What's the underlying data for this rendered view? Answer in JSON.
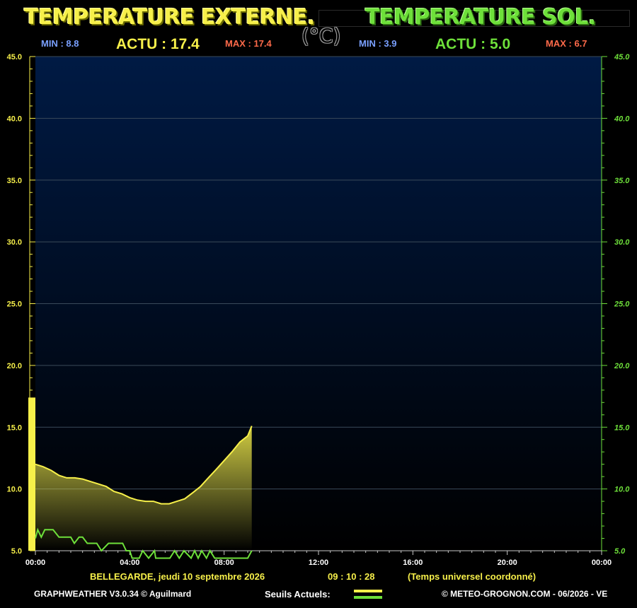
{
  "header": {
    "title_ext": "TEMPERATURE EXTERNE.",
    "title_sol": "TEMPERATURE SOL.",
    "unit": "(°C)"
  },
  "ext": {
    "min_label": "MIN : 8.8",
    "actu_label": "ACTU : 17.4",
    "max_label": "MAX : 17.4"
  },
  "sol": {
    "min_label": "MIN : 3.9",
    "actu_label": "ACTU : 5.0",
    "max_label": "MAX : 6.7"
  },
  "footer": {
    "location_date": "BELLEGARDE,  jeudi 10 septembre 2026",
    "time": "09 : 10 : 28",
    "timezone": "(Temps universel coordonné)",
    "software": "GRAPHWEATHER V3.0.34 © Aguilmard",
    "thresholds_label": "Seuils Actuels:",
    "copyright": "© METEO-GROGNON.COM - 06/2026 - VE"
  },
  "colors": {
    "ext": "#f7f04a",
    "sol": "#6ee03a",
    "min": "#7aa0ff",
    "max": "#ff6a4a",
    "plot_top": "#001a44",
    "plot_bottom": "#000000"
  },
  "chart_data": {
    "type": "area",
    "x_unit": "hours",
    "xlim": [
      0,
      24
    ],
    "x_ticks": [
      "00:00",
      "04:00",
      "08:00",
      "12:00",
      "16:00",
      "20:00",
      "00:00"
    ],
    "ylim": [
      5,
      45
    ],
    "y_ticks": [
      "5.0",
      "10.0",
      "15.0",
      "20.0",
      "25.0",
      "30.0",
      "35.0",
      "40.0",
      "45.0"
    ],
    "grid": true,
    "series": [
      {
        "key": "ext",
        "color": "#f7f04a",
        "fill": true,
        "x": [
          0,
          0.33,
          0.67,
          1.0,
          1.33,
          1.67,
          2.0,
          2.33,
          2.67,
          3.0,
          3.33,
          3.67,
          4.0,
          4.33,
          4.67,
          5.0,
          5.33,
          5.67,
          6.0,
          6.33,
          6.67,
          7.0,
          7.33,
          7.67,
          8.0,
          8.33,
          8.67,
          9.0,
          9.17
        ],
        "values": [
          12.0,
          11.8,
          11.5,
          11.1,
          10.9,
          10.9,
          10.8,
          10.6,
          10.4,
          10.2,
          9.8,
          9.6,
          9.3,
          9.1,
          9.0,
          9.0,
          8.8,
          8.8,
          9.0,
          9.2,
          9.7,
          10.2,
          10.9,
          11.6,
          12.3,
          13.0,
          13.8,
          14.3,
          15.1
        ]
      },
      {
        "key": "sol",
        "color": "#6ee03a",
        "fill": false,
        "x": [
          0,
          0.1,
          0.25,
          0.4,
          0.55,
          0.75,
          1.0,
          1.2,
          1.5,
          1.65,
          1.85,
          2.0,
          2.2,
          2.45,
          2.6,
          2.8,
          3.1,
          3.2,
          3.5,
          3.7,
          3.85,
          4.0,
          4.1,
          4.4,
          4.55,
          4.8,
          5.05,
          5.1,
          5.4,
          5.7,
          5.9,
          6.1,
          6.3,
          6.6,
          6.75,
          6.9,
          7.05,
          7.25,
          7.4,
          7.6,
          8.0,
          8.4,
          8.7,
          9.0,
          9.17
        ],
        "values": [
          6.0,
          6.7,
          6.1,
          6.7,
          6.7,
          6.7,
          6.1,
          6.1,
          6.1,
          5.6,
          6.1,
          6.1,
          5.6,
          5.6,
          5.6,
          5.0,
          5.6,
          5.6,
          5.6,
          5.6,
          5.0,
          5.0,
          4.4,
          4.4,
          5.0,
          4.4,
          5.0,
          4.4,
          4.4,
          4.4,
          5.0,
          4.4,
          5.0,
          4.4,
          5.0,
          4.4,
          5.0,
          4.4,
          5.0,
          4.4,
          4.4,
          4.4,
          4.4,
          4.4,
          5.0
        ]
      }
    ],
    "current_bar": {
      "value": 17.4,
      "color": "#f7f04a"
    }
  }
}
